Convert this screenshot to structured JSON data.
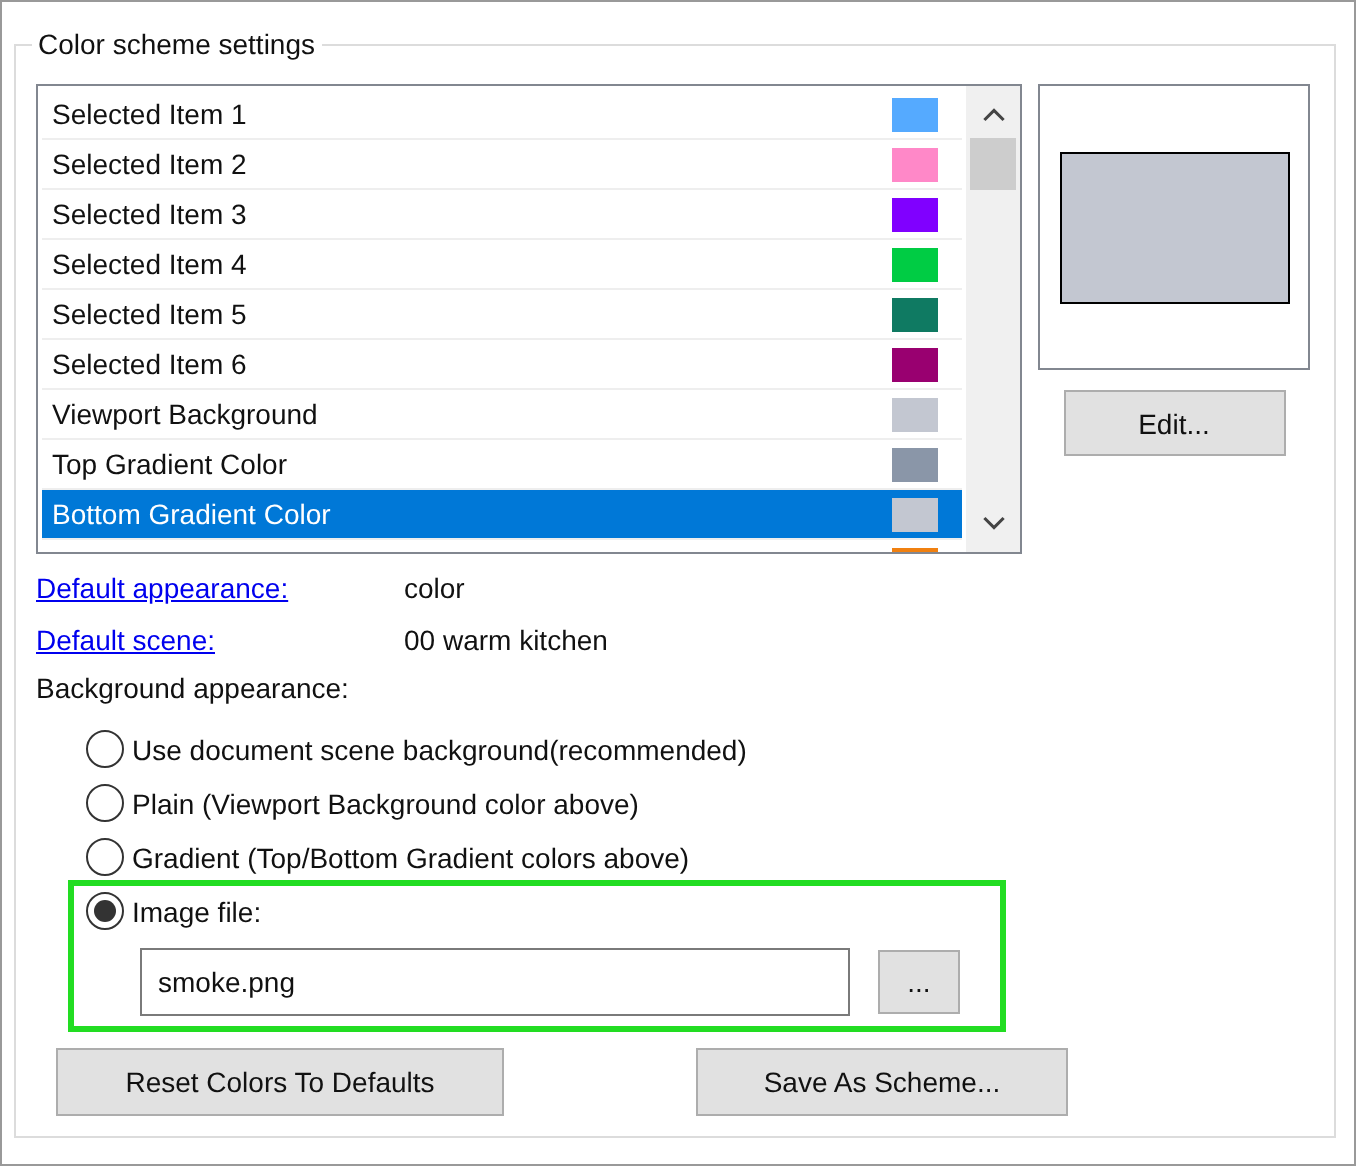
{
  "group": {
    "title": "Color scheme settings"
  },
  "items": [
    {
      "label": "Selected Item 1",
      "color": "#55aaff",
      "selected": false
    },
    {
      "label": "Selected Item 2",
      "color": "#ff88c8",
      "selected": false
    },
    {
      "label": "Selected Item 3",
      "color": "#8000ff",
      "selected": false
    },
    {
      "label": "Selected Item 4",
      "color": "#00cc44",
      "selected": false
    },
    {
      "label": "Selected Item 5",
      "color": "#0f7a62",
      "selected": false
    },
    {
      "label": "Selected Item 6",
      "color": "#990070",
      "selected": false
    },
    {
      "label": "Viewport Background",
      "color": "#c3c7d1",
      "selected": false
    },
    {
      "label": "Top Gradient Color",
      "color": "#8a96a8",
      "selected": false
    },
    {
      "label": "Bottom Gradient Color",
      "color": "#c3c7d1",
      "selected": true
    },
    {
      "color": "#f08010",
      "selected": false
    }
  ],
  "edit_button": "Edit...",
  "defaults": [
    {
      "link": "Default appearance:",
      "value": "color"
    },
    {
      "link": "Default scene:",
      "value": "00 warm kitchen"
    }
  ],
  "background_label": "Background appearance:",
  "options": [
    {
      "label": "Use document scene background(recommended)",
      "selected": false
    },
    {
      "label": "Plain (Viewport Background color above)",
      "selected": false
    },
    {
      "label": "Gradient (Top/Bottom Gradient colors above)",
      "selected": false
    },
    {
      "label": "Image file:",
      "selected": true
    }
  ],
  "image_file": {
    "value": "smoke.png",
    "browse": "...",
    "highlighted": true
  },
  "buttons": [
    "Reset Colors To Defaults",
    "Save As Scheme..."
  ]
}
